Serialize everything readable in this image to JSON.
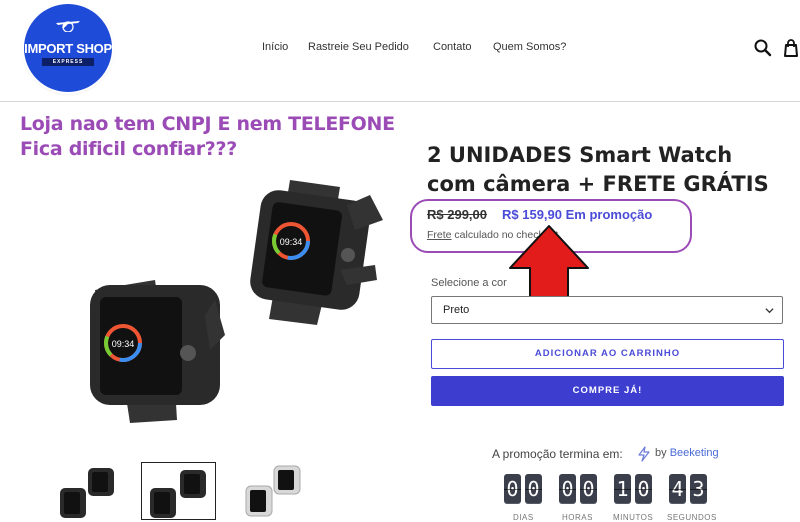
{
  "header": {
    "logo": {
      "line1": "IMPORT SHOP",
      "line2": "EXPRESS"
    },
    "nav": [
      "Início",
      "Rastreie Seu Pedido",
      "Contato",
      "Quem Somos?"
    ],
    "icons": [
      "search-icon",
      "cart-icon"
    ]
  },
  "annotation": {
    "line1": "Loja nao tem CNPJ E nem TELEFONE",
    "line2": "Fica dificil confiar???",
    "color": "#9b4bb5",
    "arrow_color": "#e21b1b"
  },
  "product": {
    "title": "2 UNIDADES Smart Watch com câmera + FRETE GRÁTIS",
    "price_old": "R$ 299,00",
    "price_new": "R$ 159,90 Em promoção",
    "shipping_link": "Frete",
    "shipping_rest": " calculado no checkout.",
    "select_label": "Selecione a cor",
    "select_value": "Preto",
    "add_to_cart": "ADICIONAR AO CARRINHO",
    "buy_now": "COMPRE JÁ!",
    "accent_color": "#3d3dd0"
  },
  "countdown": {
    "label": "A promoção termina em:",
    "by": "by",
    "brand": "Beeketing",
    "digits": [
      "0",
      "0",
      "0",
      "0",
      "1",
      "0",
      "4",
      "3"
    ],
    "units": [
      "DIAS",
      "HORAS",
      "MINUTOS",
      "SEGUNDOS"
    ]
  }
}
